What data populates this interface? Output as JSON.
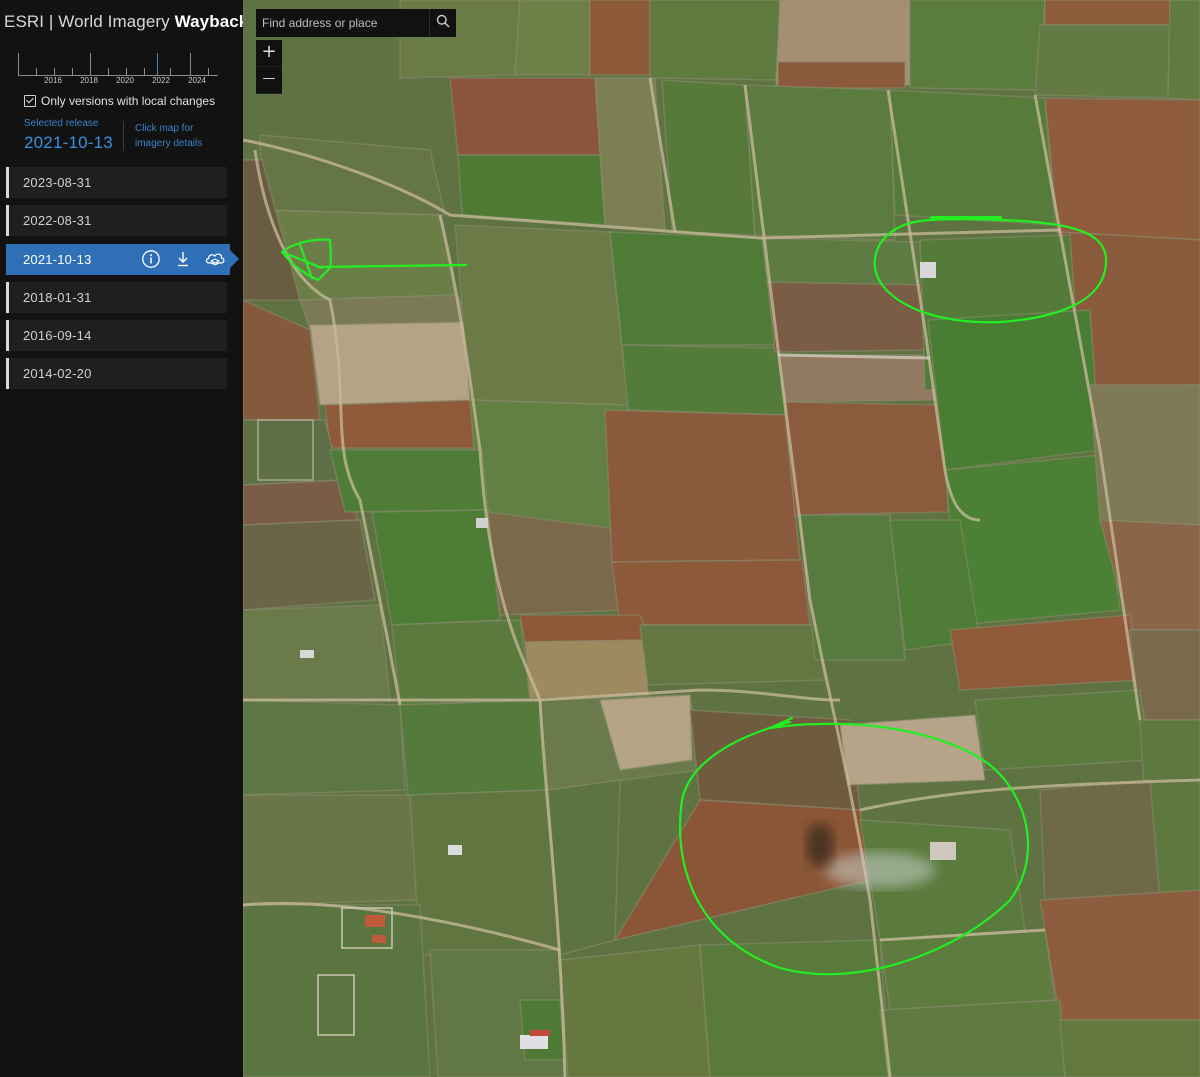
{
  "app": {
    "title_prefix": "ESRI | World Imagery ",
    "title_strong": "Wayback"
  },
  "timeline": {
    "year_labels": [
      "2016",
      "2018",
      "2020",
      "2022",
      "2024"
    ],
    "current_marker_color": "#3b82c9"
  },
  "filter": {
    "checked": true,
    "label": "Only versions with local changes"
  },
  "selected": {
    "caption": "Selected release",
    "value": "2021-10-13"
  },
  "hint": {
    "text": "Click map for imagery details"
  },
  "releases": [
    {
      "date": "2023-08-31",
      "active": false
    },
    {
      "date": "2022-08-31",
      "active": false
    },
    {
      "date": "2021-10-13",
      "active": true
    },
    {
      "date": "2018-01-31",
      "active": false
    },
    {
      "date": "2016-09-14",
      "active": false
    },
    {
      "date": "2014-02-20",
      "active": false
    }
  ],
  "release_actions": [
    "info-icon",
    "download-icon",
    "cloud-layers-icon"
  ],
  "search": {
    "placeholder": "Find address or place"
  },
  "zoom": {
    "in_label": "+",
    "out_label": "—"
  },
  "colors": {
    "sidebar_bg": "#121212",
    "accent": "#2f6fb6",
    "annotation": "#22ee22"
  }
}
